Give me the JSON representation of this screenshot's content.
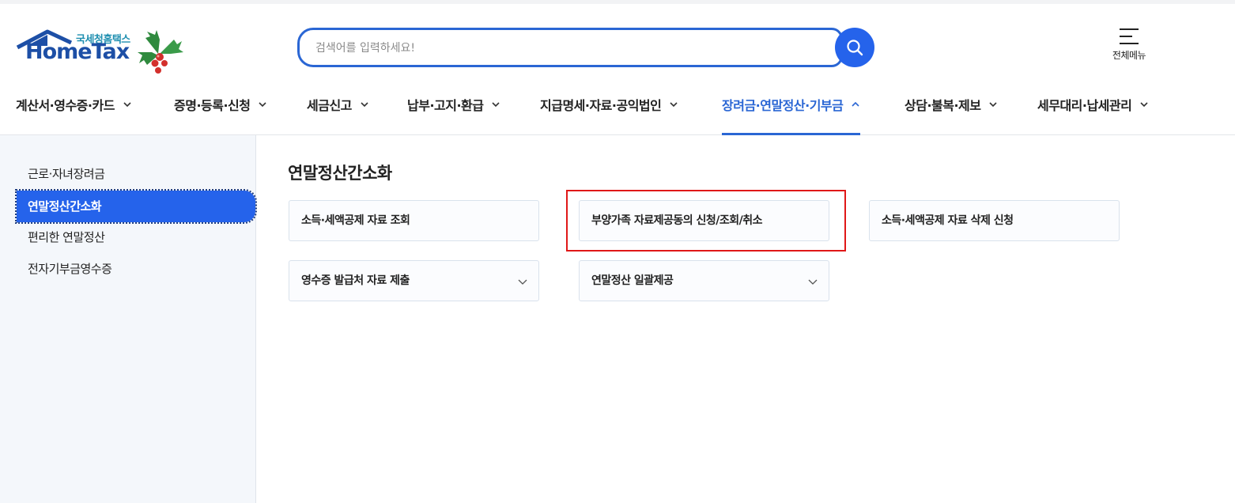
{
  "header": {
    "logo_sub": "국세청홈택스",
    "logo_main": "HomeTax",
    "search_placeholder": "검색어를 입력하세요!",
    "all_menu_label": "전체메뉴"
  },
  "nav": {
    "items": [
      {
        "label": "계산서·영수증·카드"
      },
      {
        "label": "증명·등록·신청"
      },
      {
        "label": "세금신고"
      },
      {
        "label": "납부·고지·환급"
      },
      {
        "label": "지급명세·자료·공익법인"
      },
      {
        "label": "장려금·연말정산·기부금",
        "active": true
      },
      {
        "label": "상담·불복·제보"
      },
      {
        "label": "세무대리·납세관리"
      }
    ]
  },
  "sidebar": {
    "items": [
      {
        "label": "근로·자녀장려금"
      },
      {
        "label": "연말정산간소화",
        "active": true
      },
      {
        "label": "편리한 연말정산"
      },
      {
        "label": "전자기부금영수증"
      }
    ]
  },
  "main": {
    "title": "연말정산간소화",
    "cards": [
      {
        "label": "소득·세액공제 자료 조회"
      },
      {
        "label": "부양가족 자료제공동의 신청/조회/취소"
      },
      {
        "label": "소득·세액공제 자료 삭제 신청"
      },
      {
        "label": "영수증 발급처 자료 제출",
        "expandable": true
      },
      {
        "label": "연말정산 일괄제공",
        "expandable": true
      }
    ]
  },
  "colors": {
    "accent": "#2563eb",
    "highlight_box": "#e01818",
    "sidebar_bg": "#f4f7fb"
  }
}
